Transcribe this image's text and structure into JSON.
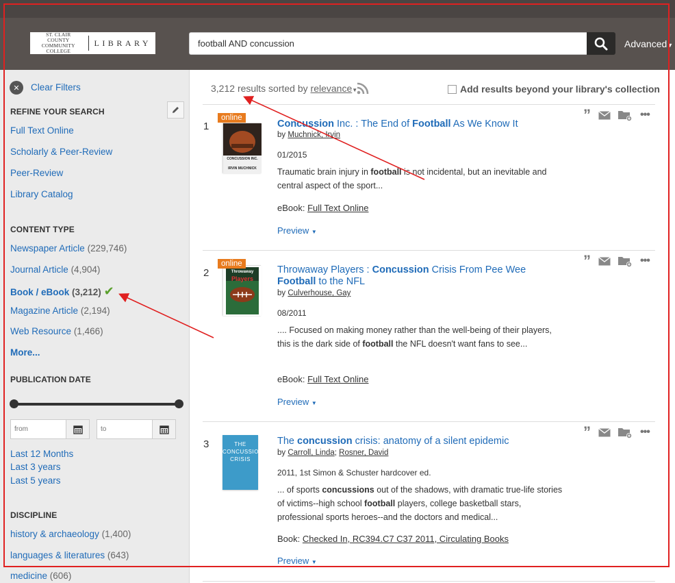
{
  "header": {
    "logo_line1": "ST. CLAIR COUNTY",
    "logo_line2": "COMMUNITY COLLEGE",
    "logo_right": "LIBRARY",
    "search_value": "football AND concussion",
    "advanced_label": "Advanced"
  },
  "sidebar": {
    "clear_filters": "Clear Filters",
    "refine_heading": "REFINE YOUR SEARCH",
    "refine_items": [
      "Full Text Online",
      "Scholarly & Peer-Review",
      "Peer-Review",
      "Library Catalog"
    ],
    "content_type_heading": "CONTENT TYPE",
    "content_types": [
      {
        "label": "Newspaper Article",
        "count": "(229,746)"
      },
      {
        "label": "Journal Article",
        "count": "(4,904)"
      },
      {
        "label": "Book / eBook",
        "count": "(3,212)"
      },
      {
        "label": "Magazine Article",
        "count": "(2,194)"
      },
      {
        "label": "Web Resource",
        "count": "(1,466)"
      }
    ],
    "more_label": "More...",
    "pubdate_heading": "PUBLICATION DATE",
    "from_placeholder": "from",
    "to_placeholder": "to",
    "date_links": [
      "Last 12 Months",
      "Last 3 years",
      "Last 5 years"
    ],
    "discipline_heading": "DISCIPLINE",
    "disciplines": [
      {
        "label": "history & archaeology",
        "count": "(1,400)"
      },
      {
        "label": "languages & literatures",
        "count": "(643)"
      },
      {
        "label": "medicine",
        "count": "(606)"
      }
    ]
  },
  "results_bar": {
    "count": "3,212",
    "sorted_by": "results sorted by",
    "sort_value": "relevance",
    "beyond_label": "Add results beyond your library's collection"
  },
  "results": [
    {
      "num": "1",
      "badge": "online",
      "title_parts": [
        "Concussion",
        " Inc. : The End of ",
        "Football",
        " As We Know It"
      ],
      "by": "by",
      "authors": [
        "Muchnick, Irvin"
      ],
      "date": "01/2015",
      "snippet_parts": [
        "Traumatic brain injury in ",
        "football",
        " is not incidental, but an inevitable and central aspect of the sport..."
      ],
      "format_label": "eBook:",
      "format_value": "Full Text Online",
      "preview": "Preview",
      "cover_caption1": "CONCUSSION INC.",
      "cover_caption2": "IRVIN MUCHNICK"
    },
    {
      "num": "2",
      "badge": "online",
      "title_parts": [
        "Throwaway Players : ",
        "Concussion",
        " Crisis From Pee Wee ",
        "Football",
        " to the NFL"
      ],
      "by": "by",
      "authors": [
        "Culverhouse, Gay"
      ],
      "date": "08/2011",
      "snippet_parts": [
        ".... Focused on making money rather than the well-being of their players, this is the dark side of ",
        "football",
        " the NFL doesn't want fans to see..."
      ],
      "format_label": "eBook:",
      "format_value": "Full Text Online",
      "preview": "Preview",
      "cover_caption1": "Throwaway",
      "cover_caption2": "Players"
    },
    {
      "num": "3",
      "title_parts": [
        "The ",
        "concussion",
        " crisis: anatomy of a silent epidemic"
      ],
      "by": "by",
      "authors": [
        "Carroll, Linda",
        "Rosner, David"
      ],
      "date": "2011, 1st Simon & Schuster hardcover ed.",
      "snippet_parts": [
        "... of sports ",
        "concussions",
        " out of the shadows, with dramatic true-life stories of victims--high school ",
        "football",
        " players, college basketball stars, professional sports heroes--and the doctors and medical..."
      ],
      "format_label": "Book:",
      "format_value": "Checked In, RC394.C7 C37 2011, Circulating Books",
      "preview": "Preview",
      "cover_caption1": "THE",
      "cover_caption2": "CONCUSSION",
      "cover_caption3": "CRISIS"
    }
  ],
  "colors": {
    "header_bg": "#58524f",
    "link_blue": "#1f6bb8",
    "online_orange": "#e87b1e",
    "check_green": "#5aa02c",
    "annotation_red": "#e02020"
  }
}
